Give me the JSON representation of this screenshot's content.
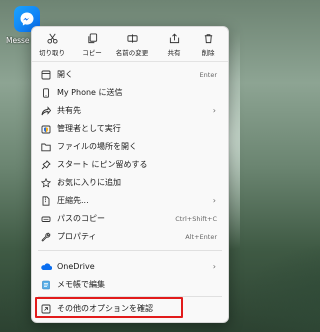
{
  "desktop": {
    "icon_label": "Messe"
  },
  "toolbar": {
    "cut": "切り取り",
    "copy": "コピー",
    "rename": "名前の変更",
    "share": "共有",
    "delete": "削除"
  },
  "menu": {
    "open": {
      "label": "開く",
      "shortcut": "Enter"
    },
    "send_phone": {
      "label": "My Phone に送信"
    },
    "share_to": {
      "label": "共有先",
      "arrow": "›"
    },
    "run_admin": {
      "label": "管理者として実行"
    },
    "open_location": {
      "label": "ファイルの場所を開く"
    },
    "pin_start": {
      "label": "スタート にピン留めする"
    },
    "add_fav": {
      "label": "お気に入りに追加"
    },
    "compress": {
      "label": "圧縮先...",
      "arrow": "›"
    },
    "copy_path": {
      "label": "パスのコピー",
      "shortcut": "Ctrl+Shift+C"
    },
    "properties": {
      "label": "プロパティ",
      "shortcut": "Alt+Enter"
    },
    "onedrive": {
      "label": "OneDrive",
      "arrow": "›"
    },
    "notepad": {
      "label": "メモ帳で編集"
    },
    "more_options": {
      "label": "その他のオプションを確認"
    }
  },
  "colors": {
    "accent": "#0a6ef0",
    "highlight_border": "#e21b1b",
    "menu_bg": "#f9f9f9"
  }
}
